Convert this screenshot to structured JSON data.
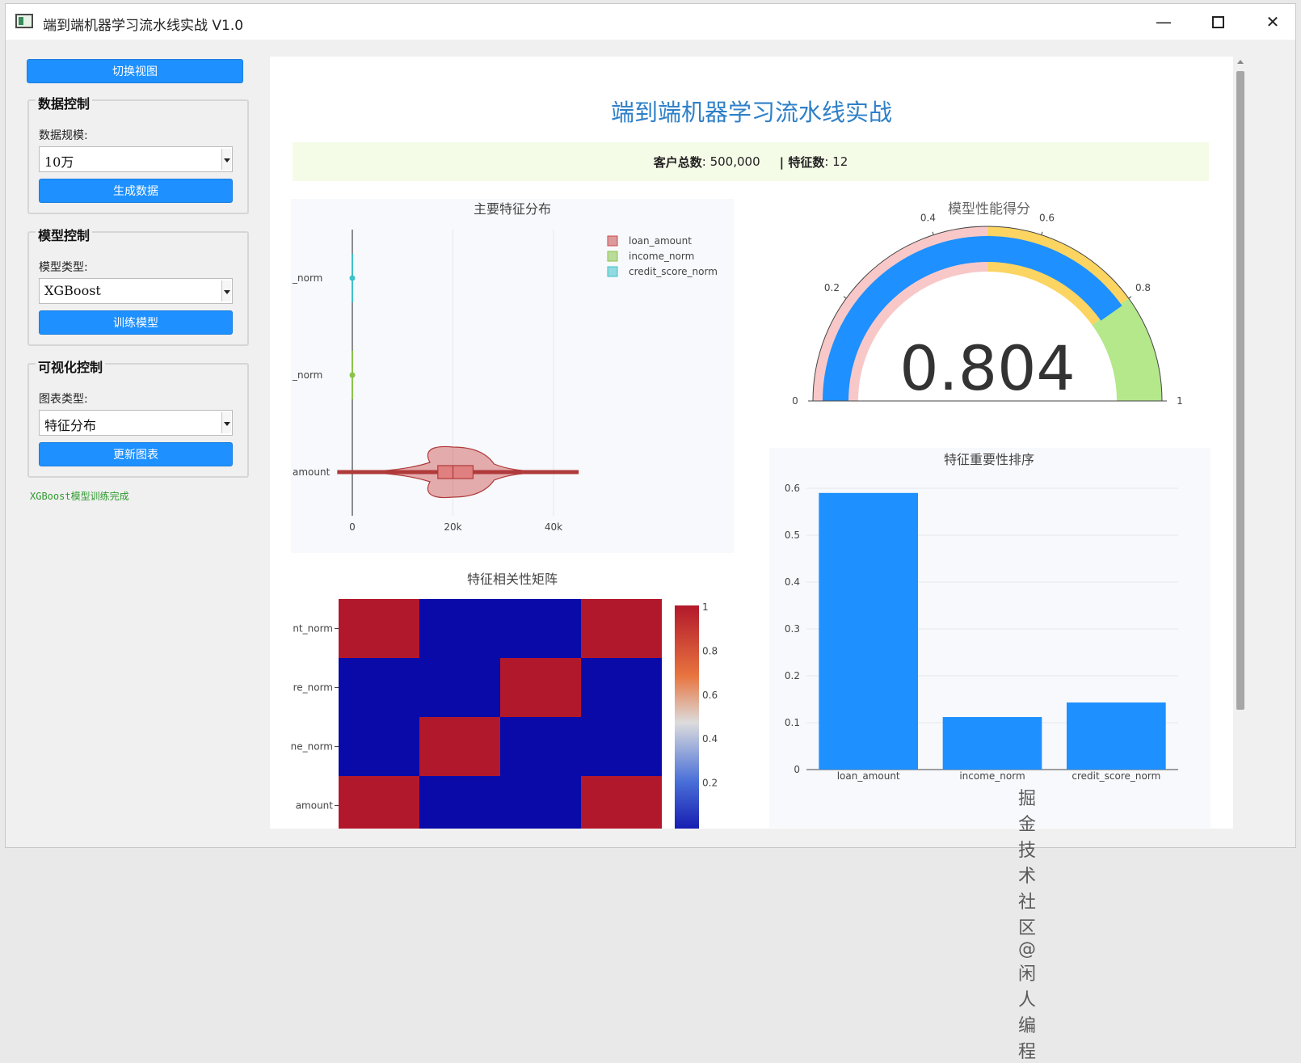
{
  "window": {
    "title": "端到端机器学习流水线实战 V1.0",
    "minimize": "—",
    "close": "✕"
  },
  "sidebar": {
    "switch_view_button": "切换视图",
    "data_group": {
      "title": "数据控制",
      "scale_label": "数据规模:",
      "scale_value": "10万",
      "generate_button": "生成数据"
    },
    "model_group": {
      "title": "模型控制",
      "type_label": "模型类型:",
      "type_value": "XGBoost",
      "train_button": "训练模型"
    },
    "viz_group": {
      "title": "可视化控制",
      "chart_type_label": "图表类型:",
      "chart_type_value": "特征分布",
      "update_button": "更新图表"
    },
    "status_text": "XGBoost模型训练完成"
  },
  "dashboard": {
    "title": "端到端机器学习流水线实战",
    "stats": {
      "customers_label": "客户总数",
      "customers_value": ": 500,000",
      "features_label": "| 特征数",
      "features_value": ": 12"
    }
  },
  "colors": {
    "accent": "#1e90ff",
    "loan_amount": "#c94c4c",
    "income_norm": "#8bc34a",
    "credit_score_norm": "#3fc1c9",
    "heat_high": "#b2182b",
    "heat_low": "#0a0aa8"
  },
  "watermark": "掘金技术社区 @ 闲人编程",
  "chart_data": [
    {
      "type": "violin",
      "title": "主要特征分布",
      "legend_position": "top-right",
      "series": [
        {
          "name": "loan_amount",
          "tick": "amount",
          "median": 20000,
          "q1": 17000,
          "q3": 24000,
          "min": -3000,
          "max": 45000,
          "kde_extent": [
            9000,
            33000
          ]
        },
        {
          "name": "income_norm",
          "tick": "_norm",
          "median": 0
        },
        {
          "name": "credit_score_norm",
          "tick": "_norm",
          "median": 0
        }
      ],
      "x_ticks": [
        "0",
        "20k",
        "40k"
      ],
      "x_values": [
        0,
        20000,
        40000
      ],
      "xlim": [
        -12000,
        47000
      ]
    },
    {
      "type": "gauge",
      "title": "模型性能得分",
      "value": 0.804,
      "value_label": "0.804",
      "range": [
        0,
        1
      ],
      "ticks": [
        "0",
        "0.2",
        "0.4",
        "0.6",
        "0.8",
        "1"
      ],
      "steps": [
        {
          "range": [
            0,
            0.5
          ],
          "color": "#f8c8c8"
        },
        {
          "range": [
            0.5,
            0.8
          ],
          "color": "#fbd461"
        },
        {
          "range": [
            0.8,
            1
          ],
          "color": "#b4e88a"
        }
      ],
      "bar_color": "#1e90ff"
    },
    {
      "type": "heatmap",
      "title": "特征相关性矩阵",
      "row_labels": [
        "nt_norm",
        "re_norm",
        "ne_norm",
        "amount"
      ],
      "matrix": [
        [
          1,
          0,
          0,
          1
        ],
        [
          0,
          0,
          1,
          0
        ],
        [
          0,
          1,
          0,
          0
        ],
        [
          1,
          0,
          0,
          1
        ]
      ],
      "colorbar_ticks": [
        "1",
        "0.8",
        "0.6",
        "0.4",
        "0.2"
      ],
      "colorbar_values": [
        1,
        0.8,
        0.6,
        0.4,
        0.2
      ]
    },
    {
      "type": "bar",
      "title": "特征重要性排序",
      "categories": [
        "loan_amount",
        "income_norm",
        "credit_score_norm"
      ],
      "values": [
        0.59,
        0.112,
        0.143
      ],
      "ylim": [
        0,
        0.6
      ],
      "y_ticks": [
        "0",
        "0.1",
        "0.2",
        "0.3",
        "0.4",
        "0.5",
        "0.6"
      ],
      "y_values": [
        0,
        0.1,
        0.2,
        0.3,
        0.4,
        0.5,
        0.6
      ]
    }
  ]
}
